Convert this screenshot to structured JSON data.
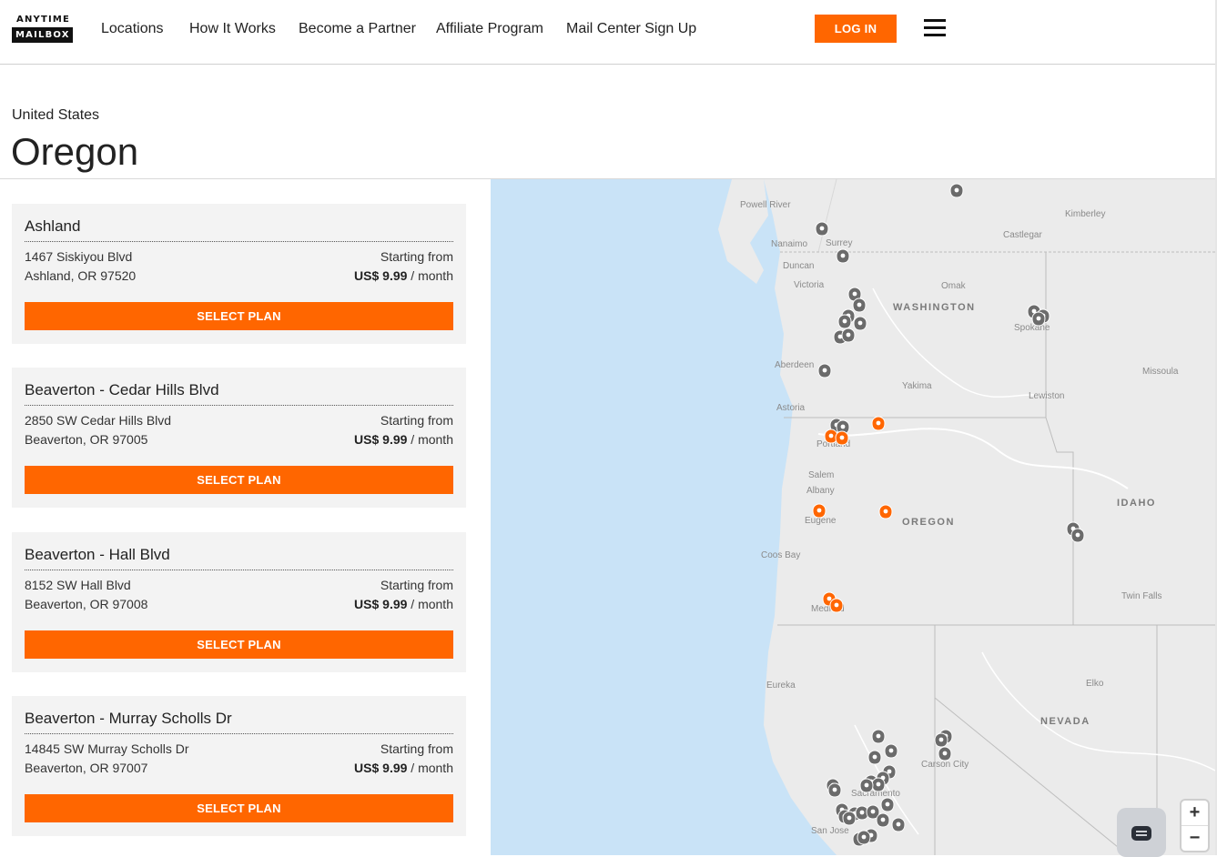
{
  "header": {
    "logo_top": "ANYTIME",
    "logo_bottom": "MAILBOX",
    "nav": [
      "Locations",
      "How It Works",
      "Become a Partner",
      "Affiliate Program",
      "Mail Center Sign Up"
    ],
    "login_label": "LOG IN",
    "accent_color": "#ff6600"
  },
  "page": {
    "country": "United States",
    "state": "Oregon"
  },
  "locations": [
    {
      "name": "Ashland",
      "address1": "1467 Siskiyou Blvd",
      "address2": "Ashland, OR 97520",
      "starting_label": "Starting from",
      "price": "US$ 9.99",
      "per": "/ month",
      "button": "SELECT PLAN"
    },
    {
      "name": "Beaverton - Cedar Hills Blvd",
      "address1": "2850 SW Cedar Hills Blvd",
      "address2": "Beaverton, OR 97005",
      "starting_label": "Starting from",
      "price": "US$ 9.99",
      "per": "/ month",
      "button": "SELECT PLAN"
    },
    {
      "name": "Beaverton - Hall Blvd",
      "address1": "8152 SW Hall Blvd",
      "address2": "Beaverton, OR 97008",
      "starting_label": "Starting from",
      "price": "US$ 9.99",
      "per": "/ month",
      "button": "SELECT PLAN"
    },
    {
      "name": "Beaverton - Murray Scholls Dr",
      "address1": "14845 SW Murray Scholls Dr",
      "address2": "Beaverton, OR 97007",
      "starting_label": "Starting from",
      "price": "US$ 9.99",
      "per": "/ month",
      "button": "SELECT PLAN"
    }
  ],
  "map": {
    "city_labels": [
      "Powell River",
      "Kimberley",
      "Nanaimo",
      "Surrey",
      "Castlegar",
      "Duncan",
      "Omak",
      "Victoria",
      "Spokane",
      "Aberdeen",
      "Missoula",
      "Yakima",
      "Lewiston",
      "Astoria",
      "Portland",
      "Salem",
      "Albany",
      "Eugene",
      "Coos Bay",
      "Medford",
      "Twin Falls",
      "Eureka",
      "Elko",
      "Carson City",
      "Sacramento",
      "San Jose"
    ],
    "state_labels": [
      "WASHINGTON",
      "OREGON",
      "IDAHO",
      "NEVADA"
    ],
    "zoom_in": "+",
    "zoom_out": "−",
    "active_pin_color": "#ff6600",
    "inactive_pin_color": "#6b6b6b"
  }
}
